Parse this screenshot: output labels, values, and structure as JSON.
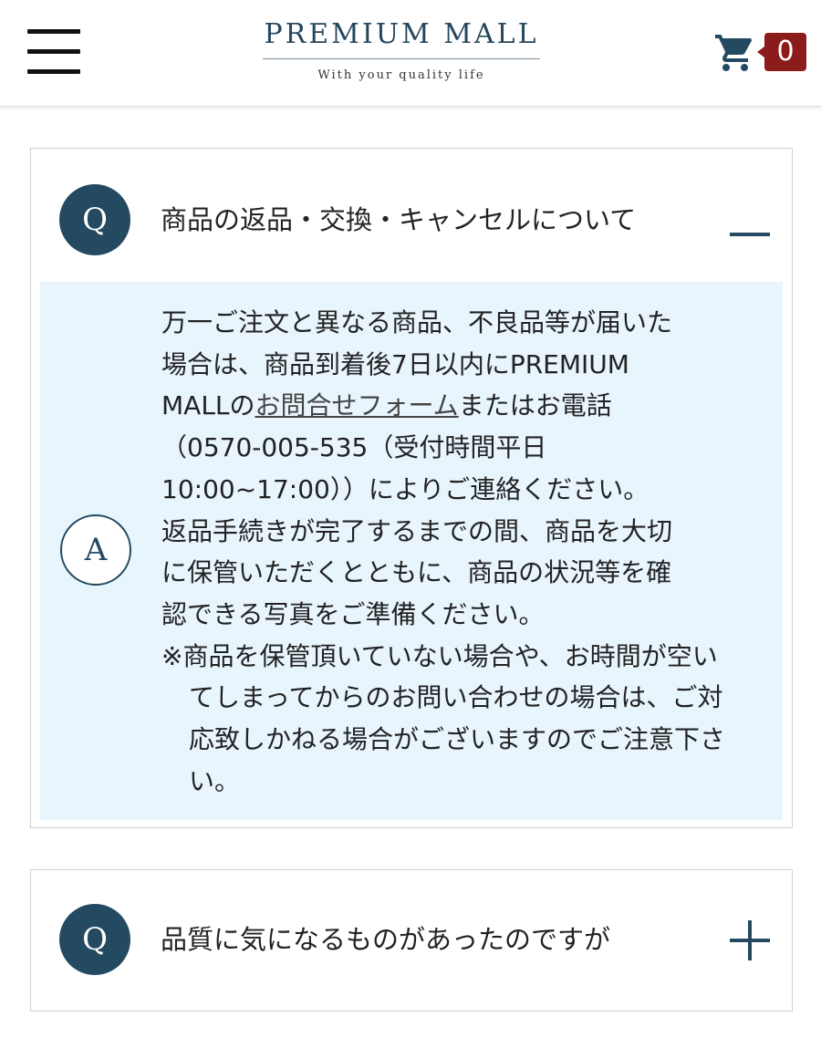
{
  "header": {
    "logo_title": "PREMIUM MALL",
    "logo_subtitle": "With your quality life",
    "menu_icon": "hamburger-icon",
    "cart_icon": "shopping-cart-icon",
    "cart_count": "0"
  },
  "colors": {
    "brand_navy": "#244a61",
    "badge_red": "#8c1c1c",
    "answer_bg": "#e8f5fd"
  },
  "faqs": [
    {
      "q_badge": "Q",
      "question": "商品の返品・交換・キャンセルについて",
      "state_icon": "minus-icon",
      "a_badge": "A",
      "answer": {
        "lines1": [
          "万一ご注文と異なる商品、不良品等が届いた",
          "場合は、商品到着後7日以内にPREMIUM"
        ],
        "line3_prefix": "MALLの",
        "link_text": "お問合せフォーム",
        "line3_suffix": "またはお電話",
        "lines2": [
          "（0570-005-535（受付時間平日",
          "10:00~17:00））によりご連絡ください。",
          "返品手続きが完了するまでの間、商品を大切",
          "に保管いただくとともに、商品の状況等を確",
          "認できる写真をご準備ください。"
        ],
        "note": "※商品を保管頂いていない場合や、お時間が空いてしまってからのお問い合わせの場合は、ご対応致しかねる場合がございますのでご注意下さい。"
      }
    },
    {
      "q_badge": "Q",
      "question": "品質に気になるものがあったのですが",
      "state_icon": "plus-icon"
    }
  ]
}
